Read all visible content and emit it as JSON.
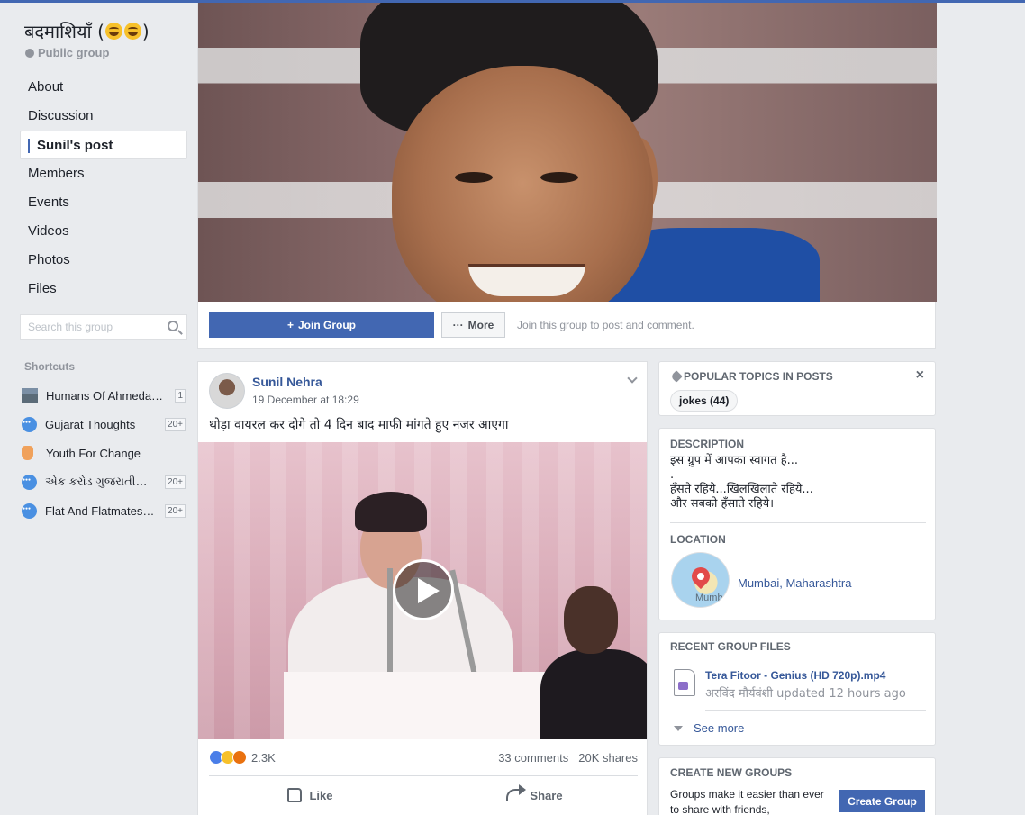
{
  "group": {
    "name": "बदमाशियाँ (",
    "name_end": ")",
    "type": "Public group"
  },
  "nav": {
    "items": [
      {
        "label": "About"
      },
      {
        "label": "Discussion"
      },
      {
        "label": "Sunil's post"
      },
      {
        "label": "Members"
      },
      {
        "label": "Events"
      },
      {
        "label": "Videos"
      },
      {
        "label": "Photos"
      },
      {
        "label": "Files"
      }
    ],
    "active": "Sunil's post"
  },
  "search": {
    "placeholder": "Search this group"
  },
  "shortcuts": {
    "title": "Shortcuts",
    "items": [
      {
        "label": "Humans Of Ahmeda…",
        "badge": "1"
      },
      {
        "label": "Gujarat Thoughts",
        "badge": "20+"
      },
      {
        "label": "Youth For Change",
        "badge": ""
      },
      {
        "label": "એક કરોડ ગુજરાતીઓનું F…",
        "badge": "20+"
      },
      {
        "label": "Flat And Flatmates…",
        "badge": "20+"
      }
    ]
  },
  "cover_actions": {
    "join_label": "Join Group",
    "more_label": "More",
    "hint": "Join this group to post and comment."
  },
  "post": {
    "author": "Sunil Nehra",
    "time": "19 December at 18:29",
    "text": "थोड़ा वायरल कर दोगे तो 4 दिन बाद माफी मांगते हुए नजर आएगा",
    "reactions_count": "2.3K",
    "comments": "33 comments",
    "shares": "20K shares",
    "like_label": "Like",
    "share_label": "Share"
  },
  "topics": {
    "title": "POPULAR TOPICS IN POSTS",
    "close": "×",
    "items": [
      {
        "label": "jokes (44)"
      }
    ]
  },
  "about": {
    "description_title": "DESCRIPTION",
    "description_lines": [
      "इस ग्रुप में आपका स्वागत है...",
      ".",
      "हँसते रहिये...खिलखिलाते रहिये...",
      "और सबको हँसाते रहिये।"
    ],
    "location_title": "LOCATION",
    "map_label": "Mumb",
    "location": "Mumbai, Maharashtra"
  },
  "files": {
    "title": "RECENT GROUP FILES",
    "file_name": "Tera Fitoor - Genius (HD 720p).mp4",
    "file_meta": "अरविंद मौर्यवंशी updated 12 hours ago",
    "see_more": "See more"
  },
  "create": {
    "title": "CREATE NEW GROUPS",
    "text": "Groups make it easier than ever to share with friends,",
    "button": "Create Group"
  },
  "colors": {
    "brand": "#4267b2",
    "link": "#365899",
    "background": "#e9ebee"
  }
}
